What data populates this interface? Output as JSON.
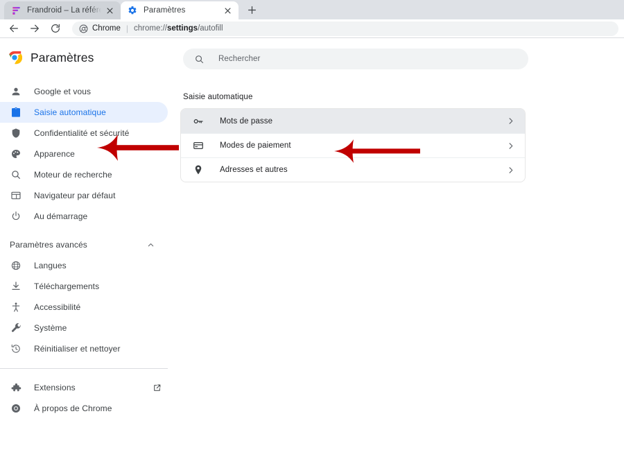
{
  "browser": {
    "tabs": [
      {
        "title": "Frandroid – La référence tech po",
        "favicon": "frandroid-f-icon",
        "active": false,
        "close_icon": "close-icon"
      },
      {
        "title": "Paramètres",
        "favicon": "gear-icon",
        "active": true,
        "close_icon": "close-icon"
      }
    ],
    "new_tab_label": "+",
    "toolbar": {
      "back_icon": "arrow-left-icon",
      "forward_icon": "arrow-right-icon",
      "reload_icon": "reload-icon",
      "omnibox": {
        "chip_label": "Chrome",
        "url_prefix": "chrome://",
        "url_bold": "settings",
        "url_suffix": "/autofill"
      }
    }
  },
  "settings": {
    "brand_title": "Paramètres",
    "brand_icon": "chrome-logo-icon",
    "sidebar": {
      "items": [
        {
          "label": "Google et vous",
          "icon": "person-icon",
          "selected": false
        },
        {
          "label": "Saisie automatique",
          "icon": "clipboard-icon",
          "selected": true
        },
        {
          "label": "Confidentialité et sécurité",
          "icon": "shield-icon",
          "selected": false
        },
        {
          "label": "Apparence",
          "icon": "palette-icon",
          "selected": false
        },
        {
          "label": "Moteur de recherche",
          "icon": "search-icon",
          "selected": false
        },
        {
          "label": "Navigateur par défaut",
          "icon": "browser-window-icon",
          "selected": false
        },
        {
          "label": "Au démarrage",
          "icon": "power-icon",
          "selected": false
        }
      ],
      "advanced_section": {
        "label": "Paramètres avancés",
        "caret_icon": "chevron-up-icon",
        "items": [
          {
            "label": "Langues",
            "icon": "globe-icon"
          },
          {
            "label": "Téléchargements",
            "icon": "download-icon"
          },
          {
            "label": "Accessibilité",
            "icon": "accessibility-icon"
          },
          {
            "label": "Système",
            "icon": "wrench-icon"
          },
          {
            "label": "Réinitialiser et nettoyer",
            "icon": "restore-clock-icon"
          }
        ]
      },
      "footer_items": [
        {
          "label": "Extensions",
          "icon": "puzzle-icon",
          "trailing_icon": "open-in-new-icon"
        },
        {
          "label": "À propos de Chrome",
          "icon": "chrome-outline-icon",
          "trailing_icon": ""
        }
      ]
    },
    "search": {
      "placeholder": "Rechercher",
      "icon": "search-icon"
    },
    "main": {
      "section_title": "Saisie automatique",
      "rows": [
        {
          "label": "Mots de passe",
          "icon": "key-icon",
          "chevron": "chevron-right-icon",
          "highlighted": true
        },
        {
          "label": "Modes de paiement",
          "icon": "credit-card-icon",
          "chevron": "chevron-right-icon",
          "highlighted": false
        },
        {
          "label": "Adresses et autres",
          "icon": "location-pin-icon",
          "chevron": "chevron-right-icon",
          "highlighted": false
        }
      ]
    }
  },
  "annotations": {
    "color": "#C00000",
    "arrows": [
      {
        "name": "arrow-pointing-to-saisie-automatique",
        "points_to": "Saisie automatique"
      },
      {
        "name": "arrow-pointing-to-mots-de-passe",
        "points_to": "Mots de passe"
      }
    ]
  },
  "colors": {
    "accent_blue": "#1a73e8",
    "selected_nav_bg": "#e8f0fe",
    "highlight_row_bg": "#e8eaed",
    "tabstrip_bg": "#dee1e6",
    "annotation_red": "#C00000"
  }
}
